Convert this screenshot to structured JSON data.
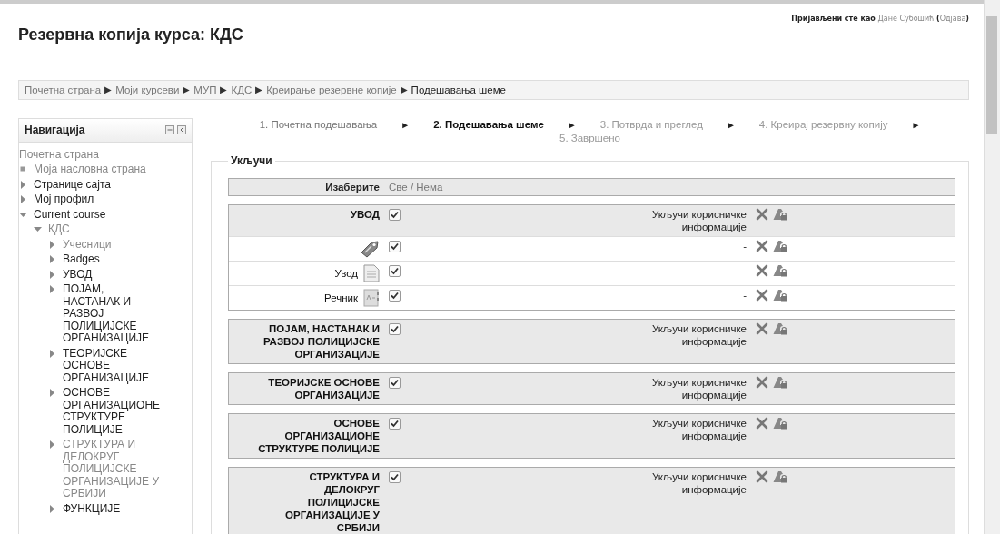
{
  "header": {
    "title": "Резервна копија курса: КДС",
    "login_prefix": "Пријављени сте као",
    "user": "Дане Субошић",
    "logout_open": "(",
    "logout": "Одјава",
    "logout_close": ")"
  },
  "breadcrumb_separator": "▶",
  "breadcrumb": [
    "Почетна страна",
    "Моји курсеви",
    "МУП",
    "КДС",
    "Креирање резервне копије",
    "Подешавања шеме"
  ],
  "navigation": {
    "title": "Навигација",
    "items": [
      {
        "label": "Почетна страна",
        "kind": "home",
        "dimmed": true
      },
      {
        "label": "Моја насловна страна",
        "kind": "leaf",
        "dimmed": true
      },
      {
        "label": "Странице сајта",
        "kind": "branch",
        "expanded": false,
        "dimmed": false
      },
      {
        "label": "Мој профил",
        "kind": "branch",
        "expanded": false,
        "dimmed": false
      },
      {
        "label": "Current course",
        "kind": "branch",
        "expanded": true,
        "dimmed": false,
        "children": [
          {
            "label": "КДС",
            "kind": "branch",
            "expanded": true,
            "dimmed": true,
            "children": [
              {
                "label": "Учесници",
                "kind": "branch",
                "expanded": false,
                "dimmed": true
              },
              {
                "label": "Badges",
                "kind": "branch",
                "expanded": false,
                "dimmed": false
              },
              {
                "label": "УВОД",
                "kind": "branch",
                "expanded": false,
                "dimmed": false
              },
              {
                "label": "ПОЈАМ, НАСТАНАК И РАЗВОЈ ПОЛИЦИЈСКЕ ОРГАНИЗАЦИЈЕ",
                "kind": "branch",
                "expanded": false,
                "dimmed": false
              },
              {
                "label": "ТЕОРИЈСКЕ ОСНОВЕ ОРГАНИЗАЦИЈЕ",
                "kind": "branch",
                "expanded": false,
                "dimmed": false
              },
              {
                "label": "ОСНОВЕ ОРГАНИЗАЦИОНЕ СТРУКТУРЕ ПОЛИЦИЈЕ",
                "kind": "branch",
                "expanded": false,
                "dimmed": false
              },
              {
                "label": "СТРУКТУРА И ДЕЛОКРУГ ПОЛИЦИЈСКЕ ОРГАНИЗАЦИЈЕ У СРБИЈИ",
                "kind": "branch",
                "expanded": false,
                "dimmed": true
              },
              {
                "label": "ФУНКЦИЈЕ",
                "kind": "branch",
                "expanded": false,
                "dimmed": false
              }
            ]
          }
        ]
      }
    ]
  },
  "steps": [
    {
      "label": "1. Почетна подешавања",
      "selected": false
    },
    {
      "label": "2. Подешавања шеме",
      "selected": true
    },
    {
      "label": "3. Потврда и преглед",
      "selected": false
    },
    {
      "label": "4. Креирај резервну копију",
      "selected": false
    },
    {
      "label": "5. Завршено",
      "selected": false
    }
  ],
  "step_separator": "►",
  "include": {
    "legend": "Укључи",
    "select_label": "Изаберите",
    "select_all": "Све",
    "select_slash": "/",
    "select_none": "Нема",
    "sections": [
      {
        "title": "УВОД",
        "checked": true,
        "userinfo": "Укључи корисничке информације",
        "activities": [
          {
            "kind": "label",
            "checked": true,
            "userinfo": "-"
          },
          {
            "name": "Увод",
            "kind": "page",
            "checked": true,
            "userinfo": "-"
          },
          {
            "name": "Речник",
            "kind": "glossary",
            "checked": true,
            "userinfo": "-"
          }
        ]
      },
      {
        "title": "ПОЈАМ, НАСТАНАК И РАЗВОЈ ПОЛИЦИЈСКЕ ОРГАНИЗАЦИЈЕ",
        "checked": true,
        "userinfo": "Укључи корисничке информације"
      },
      {
        "title": "ТЕОРИЈСКЕ ОСНОВЕ ОРГАНИЗАЦИЈЕ",
        "checked": true,
        "userinfo": "Укључи корисничке информације"
      },
      {
        "title": "ОСНОВЕ ОРГАНИЗАЦИОНЕ СТРУКТУРЕ ПОЛИЦИЈЕ",
        "checked": true,
        "userinfo": "Укључи корисничке информације"
      },
      {
        "title": "СТРУКТУРА И ДЕЛОКРУГ ПОЛИЦИЈСКЕ ОРГАНИЗАЦИЈЕ У СРБИЈИ",
        "checked": true,
        "userinfo": "Укључи корисничке информације"
      }
    ]
  }
}
